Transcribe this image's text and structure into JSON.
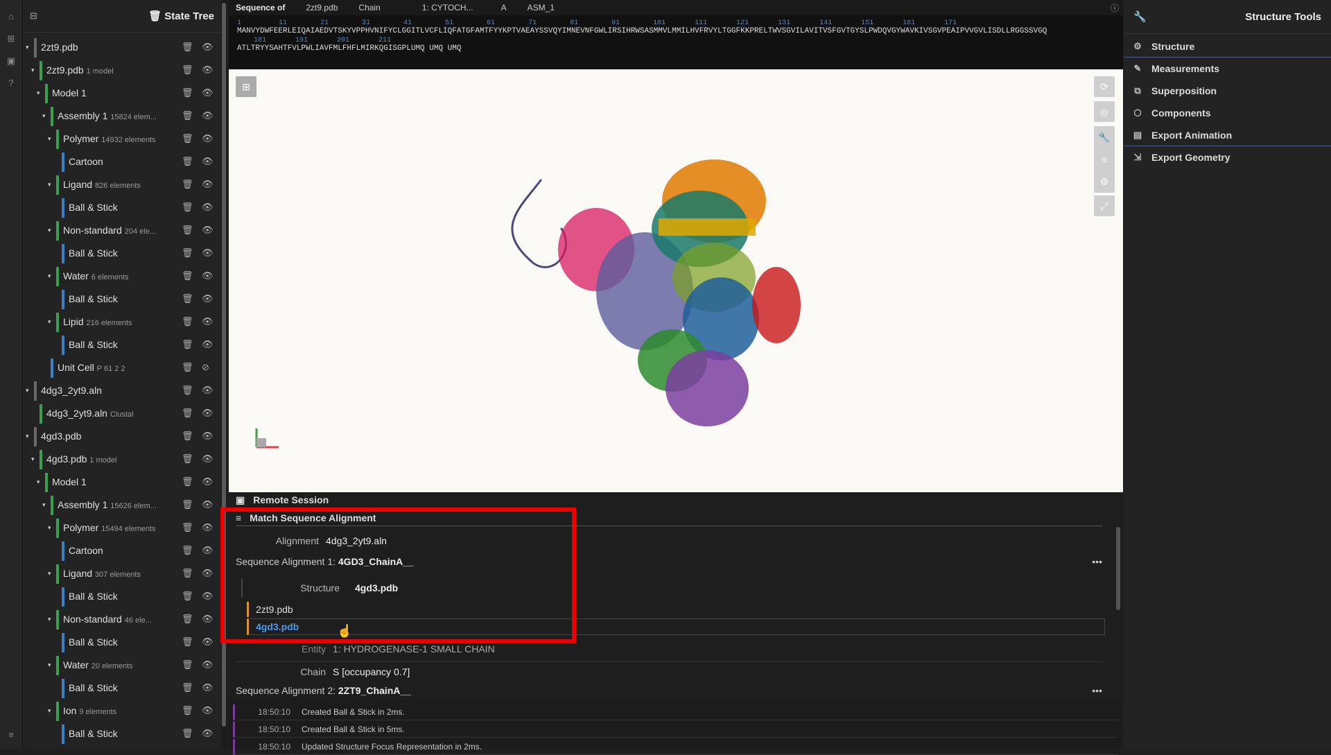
{
  "app": {
    "left_title": "State Tree",
    "right_title": "Structure Tools"
  },
  "sequence_bar": {
    "label": "Sequence of",
    "structure": "2zt9.pdb",
    "mode": "Chain",
    "entity": "1: CYTOCH...",
    "chain": "A",
    "assembly": "ASM_1",
    "numbers_line1": "1         11        21        31        41        51        61        71        81        91        101       111       121       131       141       151       161       171",
    "sequence_line1": "MANVYDWFEERLEIQAIAEDVTSKYVPPHVNIFYCLGGITLVCFLIQFATGFAMTFYYKPTVAEAYSSVQYIMNEVNFGWLIRSIHRWSASMMVLMMILHVFRVYLTGGFKKPRELTWVSGVILAVITVSFGVTGYSLPWDQVGYWAVKIVSGVPEAIPVVGVLISDLLRGGSSVGQ",
    "numbers_line2": "    181       191       201       211",
    "sequence_line2": "ATLTRYYSAHTFVLPWLIAVFMLFHFLMIRKQGISGPLUMQ UMQ UMQ"
  },
  "tree": [
    {
      "label": "2zt9.pdb",
      "sub": "",
      "indent": 0,
      "bar": "#6a6a6a",
      "caret": "▾",
      "hidden": false
    },
    {
      "label": "2zt9.pdb",
      "sub": "1 model",
      "indent": 1,
      "bar": "#3aa050",
      "caret": "▾",
      "hidden": false
    },
    {
      "label": "Model 1",
      "sub": "",
      "indent": 2,
      "bar": "#3aa050",
      "caret": "▾",
      "hidden": false
    },
    {
      "label": "Assembly 1",
      "sub": "15824 elem...",
      "indent": 3,
      "bar": "#3aa050",
      "caret": "▾",
      "hidden": false
    },
    {
      "label": "Polymer",
      "sub": "14932 elements",
      "indent": 4,
      "bar": "#3aa050",
      "caret": "▾",
      "hidden": false
    },
    {
      "label": "Cartoon",
      "sub": "",
      "indent": 5,
      "bar": "#3a80c8",
      "caret": "",
      "hidden": false
    },
    {
      "label": "Ligand",
      "sub": "826 elements",
      "indent": 4,
      "bar": "#3aa050",
      "caret": "▾",
      "hidden": false
    },
    {
      "label": "Ball & Stick",
      "sub": "",
      "indent": 5,
      "bar": "#3a80c8",
      "caret": "",
      "hidden": false
    },
    {
      "label": "Non-standard",
      "sub": "204 ele...",
      "indent": 4,
      "bar": "#3aa050",
      "caret": "▾",
      "hidden": false
    },
    {
      "label": "Ball & Stick",
      "sub": "",
      "indent": 5,
      "bar": "#3a80c8",
      "caret": "",
      "hidden": false
    },
    {
      "label": "Water",
      "sub": "6 elements",
      "indent": 4,
      "bar": "#3aa050",
      "caret": "▾",
      "hidden": false
    },
    {
      "label": "Ball & Stick",
      "sub": "",
      "indent": 5,
      "bar": "#3a80c8",
      "caret": "",
      "hidden": false
    },
    {
      "label": "Lipid",
      "sub": "216 elements",
      "indent": 4,
      "bar": "#3aa050",
      "caret": "▾",
      "hidden": false
    },
    {
      "label": "Ball & Stick",
      "sub": "",
      "indent": 5,
      "bar": "#3a80c8",
      "caret": "",
      "hidden": false
    },
    {
      "label": "Unit Cell",
      "sub": "P 61 2 2",
      "indent": 3,
      "bar": "#3a80c8",
      "caret": "",
      "hidden": true
    },
    {
      "label": "4dg3_2yt9.aln",
      "sub": "",
      "indent": 0,
      "bar": "#6a6a6a",
      "caret": "▾",
      "hidden": false
    },
    {
      "label": "4dg3_2yt9.aln",
      "sub": "Clustal",
      "indent": 1,
      "bar": "#3aa050",
      "caret": "",
      "hidden": false
    },
    {
      "label": "4gd3.pdb",
      "sub": "",
      "indent": 0,
      "bar": "#6a6a6a",
      "caret": "▾",
      "hidden": false
    },
    {
      "label": "4gd3.pdb",
      "sub": "1 model",
      "indent": 1,
      "bar": "#3aa050",
      "caret": "▾",
      "hidden": false
    },
    {
      "label": "Model 1",
      "sub": "",
      "indent": 2,
      "bar": "#3aa050",
      "caret": "▾",
      "hidden": false
    },
    {
      "label": "Assembly 1",
      "sub": "15626 elem...",
      "indent": 3,
      "bar": "#3aa050",
      "caret": "▾",
      "hidden": false
    },
    {
      "label": "Polymer",
      "sub": "15494 elements",
      "indent": 4,
      "bar": "#3aa050",
      "caret": "▾",
      "hidden": false
    },
    {
      "label": "Cartoon",
      "sub": "",
      "indent": 5,
      "bar": "#3a80c8",
      "caret": "",
      "hidden": false
    },
    {
      "label": "Ligand",
      "sub": "307 elements",
      "indent": 4,
      "bar": "#3aa050",
      "caret": "▾",
      "hidden": false
    },
    {
      "label": "Ball & Stick",
      "sub": "",
      "indent": 5,
      "bar": "#3a80c8",
      "caret": "",
      "hidden": false
    },
    {
      "label": "Non-standard",
      "sub": "46 ele...",
      "indent": 4,
      "bar": "#3aa050",
      "caret": "▾",
      "hidden": false
    },
    {
      "label": "Ball & Stick",
      "sub": "",
      "indent": 5,
      "bar": "#3a80c8",
      "caret": "",
      "hidden": false
    },
    {
      "label": "Water",
      "sub": "20 elements",
      "indent": 4,
      "bar": "#3aa050",
      "caret": "▾",
      "hidden": false
    },
    {
      "label": "Ball & Stick",
      "sub": "",
      "indent": 5,
      "bar": "#3a80c8",
      "caret": "",
      "hidden": false
    },
    {
      "label": "Ion",
      "sub": "9 elements",
      "indent": 4,
      "bar": "#3aa050",
      "caret": "▾",
      "hidden": false
    },
    {
      "label": "Ball & Stick",
      "sub": "",
      "indent": 5,
      "bar": "#3a80c8",
      "caret": "",
      "hidden": false
    }
  ],
  "tools": [
    {
      "label": "Structure",
      "icon": "gear-icon"
    },
    {
      "label": "Measurements",
      "icon": "ruler-icon"
    },
    {
      "label": "Superposition",
      "icon": "copy-icon"
    },
    {
      "label": "Components",
      "icon": "cube-icon"
    },
    {
      "label": "Export Animation",
      "icon": "film-icon"
    },
    {
      "label": "Export Geometry",
      "icon": "export-icon"
    }
  ],
  "panel": {
    "remote_session": "Remote Session",
    "match_title": "Match Sequence Alignment",
    "alignment_label": "Alignment",
    "alignment_value": "4dg3_2yt9.aln",
    "seq1_prefix": "Sequence Alignment 1:",
    "seq1_name": "4GD3_ChainA__",
    "structure_label": "Structure",
    "structure_value": "4gd3.pdb",
    "options": [
      "2zt9.pdb",
      "4gd3.pdb"
    ],
    "entity_label": "Entity",
    "entity_value": "1: HYDROGENASE-1 SMALL CHAIN",
    "chain_label": "Chain",
    "chain_value": "S [occupancy 0.7]",
    "seq2_prefix": "Sequence Alignment 2:",
    "seq2_name": "2ZT9_ChainA__",
    "more": "•••"
  },
  "log": [
    {
      "time": "18:50:10",
      "msg": "Created Ball & Stick in 2ms."
    },
    {
      "time": "18:50:10",
      "msg": "Created Ball & Stick in 5ms."
    },
    {
      "time": "18:50:10",
      "msg": "Updated Structure Focus Representation in 2ms."
    }
  ],
  "colors": {
    "highlight": "#ee0000",
    "selected_option": "#4a9ae8",
    "accent_green": "#3aa050",
    "accent_blue": "#3a80c8"
  }
}
